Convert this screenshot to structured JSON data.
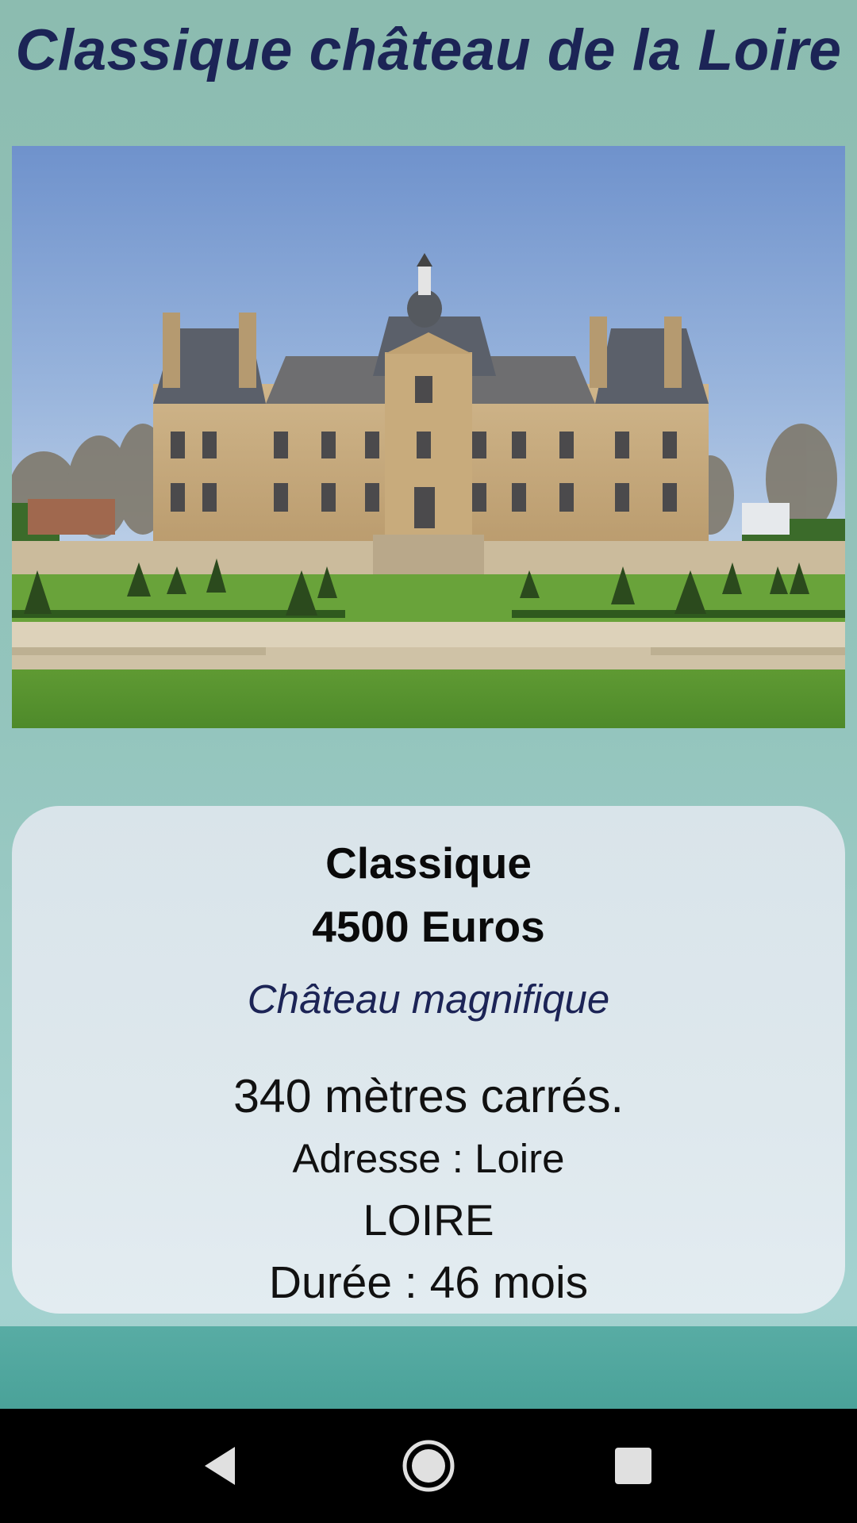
{
  "header": {
    "title": "Classique château de la Loire"
  },
  "photo": {
    "subject": "chateau-photo"
  },
  "listing": {
    "type": "Classique",
    "price": "4500 Euros",
    "description": "Château magnifique",
    "surface": "340 mètres carrés.",
    "address": "Adresse : Loire",
    "city": "LOIRE",
    "duration": "Durée : 46 mois"
  },
  "navbar": {
    "back_icon": "back-triangle-icon",
    "home_icon": "home-circle-icon",
    "recents_icon": "recents-square-icon"
  },
  "colors": {
    "title": "#1c2456",
    "background": "#93c4bc",
    "card": "#dee8ed",
    "bottom_band": "#4aa299",
    "navbar": "#000000"
  }
}
